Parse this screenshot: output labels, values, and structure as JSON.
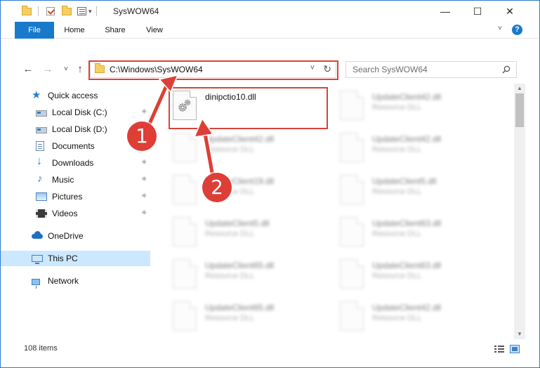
{
  "window": {
    "title": "SysWOW64",
    "minimize_glyph": "—",
    "maximize_glyph": "☐",
    "close_glyph": "✕",
    "dropdown_glyph": "▾"
  },
  "ribbon": {
    "tabs": [
      "File",
      "Home",
      "Share",
      "View"
    ],
    "expand_glyph": "˅",
    "help_glyph": "?"
  },
  "navigation": {
    "back_glyph": "←",
    "forward_glyph": "→",
    "recent_glyph": "˅",
    "up_glyph": "↑",
    "address": "C:\\Windows\\SysWOW64",
    "address_dropdown_glyph": "˅",
    "refresh_glyph": "↻",
    "search_placeholder": "Search SysWOW64"
  },
  "sidebar": {
    "items": [
      {
        "label": "Quick access",
        "icon": "star-icon",
        "pinned": false
      },
      {
        "label": "Local Disk (C:)",
        "icon": "drive-icon",
        "pinned": true
      },
      {
        "label": "Local Disk (D:)",
        "icon": "drive-icon",
        "pinned": false
      },
      {
        "label": "Documents",
        "icon": "documents-icon",
        "pinned": true
      },
      {
        "label": "Downloads",
        "icon": "downloads-icon",
        "pinned": true
      },
      {
        "label": "Music",
        "icon": "music-icon",
        "pinned": true
      },
      {
        "label": "Pictures",
        "icon": "pictures-icon",
        "pinned": true
      },
      {
        "label": "Videos",
        "icon": "videos-icon",
        "pinned": true
      },
      {
        "label": "OneDrive",
        "icon": "onedrive-icon",
        "pinned": false
      },
      {
        "label": "This PC",
        "icon": "computer-icon",
        "pinned": false,
        "selected": true
      },
      {
        "label": "Network",
        "icon": "network-icon",
        "pinned": false
      }
    ],
    "pin_glyph": "✳"
  },
  "files": [
    {
      "name": "dinipctio10.dll",
      "type": "",
      "highlighted": true
    },
    {
      "name": "UpdateClient42.dll",
      "type": "Resource DLL"
    },
    {
      "name": "UpdateClient42.dll",
      "type": "Resource DLL"
    },
    {
      "name": "UpdateClient42.dll",
      "type": "Resource DLL"
    },
    {
      "name": "UpdateClient19.dll",
      "type": "Resource DLL"
    },
    {
      "name": "UpdateClient5.dll",
      "type": "Resource DLL"
    },
    {
      "name": "UpdateClient5.dll",
      "type": "Resource DLL"
    },
    {
      "name": "UpdateClient63.dll",
      "type": "Resource DLL"
    },
    {
      "name": "UpdateClient65.dll",
      "type": "Resource DLL"
    },
    {
      "name": "UpdateClient63.dll",
      "type": "Resource DLL"
    },
    {
      "name": "UpdateClient65.dll",
      "type": "Resource DLL"
    },
    {
      "name": "UpdateClient42.dll",
      "type": "Resource DLL"
    }
  ],
  "annotations": {
    "step1": "1",
    "step2": "2",
    "color": "#d8433a"
  },
  "status": {
    "item_count": "108 items"
  },
  "scrollbar": {
    "up_glyph": "▲",
    "down_glyph": "▼"
  },
  "colors": {
    "accent": "#1979ca",
    "selected_bg": "#cce8ff",
    "annotation": "#de3e36"
  }
}
